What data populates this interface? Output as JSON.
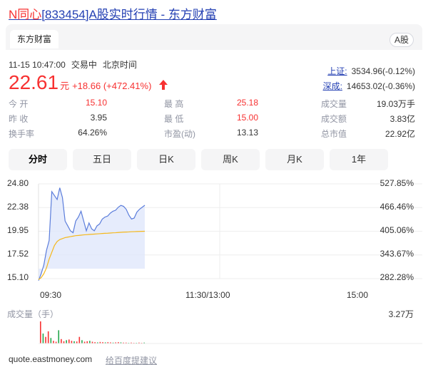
{
  "page": {
    "title_prefix": "N同心",
    "title_rest": "[833454]A股实时行情 - 东方财富"
  },
  "card": {
    "source_tab": "东方财富",
    "market_badge": "A股"
  },
  "quote": {
    "datetime": "11-15 10:47:00",
    "status": "交易中",
    "timezone": "北京时间",
    "price": "22.61",
    "unit": "元",
    "change": "+18.66 (+472.41%)",
    "up_color": "#f73131"
  },
  "indices": [
    {
      "name": "上证:",
      "value": "3534.96(-0.12%)"
    },
    {
      "name": "深成:",
      "value": "14653.02(-0.36%)"
    }
  ],
  "stats": {
    "open_label": "今  开",
    "open_value": "15.10",
    "prev_label": "昨  收",
    "prev_value": "3.95",
    "turnover_label": "换手率",
    "turnover_value": "64.26%",
    "high_label": "最  高",
    "high_value": "25.18",
    "low_label": "最  低",
    "low_value": "15.00",
    "pe_label": "市盈(动)",
    "pe_value": "13.13",
    "volume_label": "成交量",
    "volume_value": "19.03万手",
    "amount_label": "成交额",
    "amount_value": "3.83亿",
    "mcap_label": "总市值",
    "mcap_value": "22.92亿"
  },
  "tabs": [
    "分时",
    "五日",
    "日K",
    "周K",
    "月K",
    "1年"
  ],
  "chart_data": {
    "type": "line",
    "y_labels": [
      "24.80",
      "22.38",
      "19.95",
      "17.52",
      "15.10"
    ],
    "y_pct_labels": [
      "527.85%",
      "466.46%",
      "405.06%",
      "343.67%",
      "282.28%"
    ],
    "x_labels": [
      "09:30",
      "11:30/13:00",
      "15:00"
    ],
    "ylim": [
      15.1,
      24.8
    ],
    "series": [
      {
        "color": "#5b7ddb",
        "values": [
          14.9,
          15.6,
          16.5,
          18.0,
          19.0,
          24.0,
          23.6,
          23.2,
          24.4,
          23.4,
          21.0,
          20.5,
          20.0,
          19.8,
          21.0,
          21.4,
          22.0,
          21.0,
          20.0,
          20.8,
          20.2,
          20.0,
          20.5,
          20.7,
          21.2,
          21.4,
          21.5,
          21.8,
          22.0,
          22.1,
          22.4,
          22.6,
          22.5,
          22.2,
          21.6,
          21.2,
          21.3,
          21.9,
          22.2,
          22.4,
          22.61
        ]
      },
      {
        "color": "#f5b81b",
        "values": [
          15.0,
          15.2,
          15.6,
          16.2,
          17.1,
          17.8,
          18.5,
          18.9,
          19.1,
          19.2,
          19.3,
          19.35,
          19.4,
          19.45,
          19.5,
          19.52,
          19.55,
          19.58,
          19.6,
          19.62,
          19.64,
          19.66,
          19.68,
          19.7,
          19.72,
          19.74,
          19.75,
          19.77,
          19.79,
          19.8,
          19.82,
          19.84,
          19.86,
          19.87,
          19.88,
          19.9,
          19.91,
          19.92,
          19.93,
          19.94,
          19.95
        ]
      }
    ],
    "volume_label": "成交量（手）",
    "volume_max_label": "3.27万",
    "volume_fractions": [
      1.0,
      0.45,
      0.3,
      0.55,
      0.25,
      0.12,
      0.08,
      0.6,
      0.2,
      0.1,
      0.15,
      0.18,
      0.12,
      0.1,
      0.09,
      0.3,
      0.15,
      0.08,
      0.1,
      0.12,
      0.08,
      0.06,
      0.05,
      0.07,
      0.06,
      0.05,
      0.06,
      0.05,
      0.04,
      0.05,
      0.06,
      0.05,
      0.04,
      0.04,
      0.03,
      0.04,
      0.03,
      0.03,
      0.04,
      0.03,
      0.04
    ]
  },
  "footer": {
    "link": "quote.eastmoney.com",
    "suggest": "给百度提建议"
  }
}
